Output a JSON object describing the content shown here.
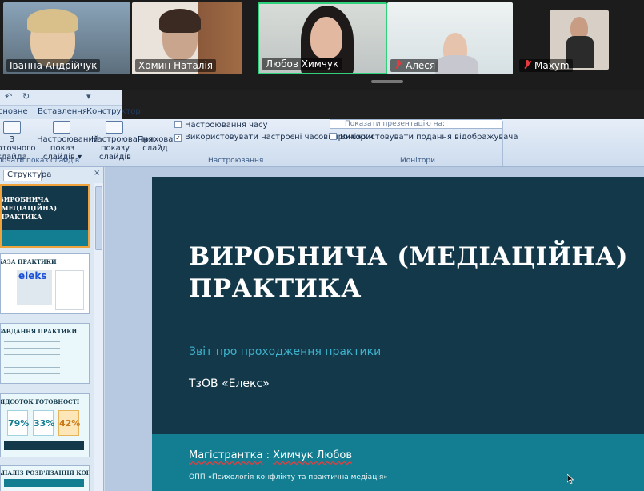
{
  "participants": [
    {
      "name": "Іванна Андрійчук",
      "muted": false,
      "active": false
    },
    {
      "name": "Хомин Наталія",
      "muted": false,
      "active": false
    },
    {
      "name": "Любов Химчук",
      "muted": false,
      "active": true
    },
    {
      "name": "Алеся",
      "muted": true,
      "active": false
    },
    {
      "name": "Maxym",
      "muted": true,
      "active": false
    }
  ],
  "ppt": {
    "qat": {
      "undo": "↶",
      "redo": "↻",
      "more": "▾"
    },
    "tabs": [
      "Основне",
      "Вставлення",
      "Конструктор"
    ],
    "ribbon": {
      "btn_from_current": "З поточного\nслайда",
      "btn_custom_show": "Настроюваний\nпоказ слайдів ▾",
      "group_start": "Почати показ слайдів",
      "btn_setup": "Настроювання\nпоказу слайдів",
      "btn_hide": "Приховати\nслайд",
      "chk_timings_label": "Настроювання часу",
      "chk_use_timings": "Використовувати настроєні часові проміжки",
      "group_setup": "Настроювання",
      "show_on": "Показати презентацію на:",
      "chk_presenter": "Використовувати подання відображувача",
      "group_monitors": "Монітори"
    },
    "pane": {
      "tab": "Структура",
      "close": "×"
    },
    "thumbnails": [
      {
        "title": "ВИРОБНИЧА (МЕДІАЦІЙНА) ПРАКТИКА"
      },
      {
        "title": "БАЗА ПРАКТИКИ",
        "logo": "eleks"
      },
      {
        "title": "ЗАВДАННЯ ПРАКТИКИ"
      },
      {
        "title": "ВІДСОТОК ГОТОВНОСТІ",
        "stats": [
          "79%",
          "33%",
          "42%"
        ]
      },
      {
        "title": "АНАЛІЗ РОЗВ'ЯЗАННЯ КОНФЛІКТІВ"
      }
    ],
    "slide": {
      "title": "ВИРОБНИЧА (МЕДІАЦІЙНА) ПРАКТИКА",
      "subtitle": "Звіт про проходження практики",
      "company": "ТзОВ «Елекс»",
      "author_label": "Магістрантка",
      "author_sep": " : ",
      "author_name": "Химчук Любов",
      "program": "ОПП «Психологія конфлікту та практична медіація»"
    }
  },
  "colors": {
    "slide_bg": "#12384a",
    "slide_band": "#137d91",
    "subtitle": "#3fb3cd",
    "active_speaker": "#2fd17a",
    "muted": "#e23b3b"
  }
}
